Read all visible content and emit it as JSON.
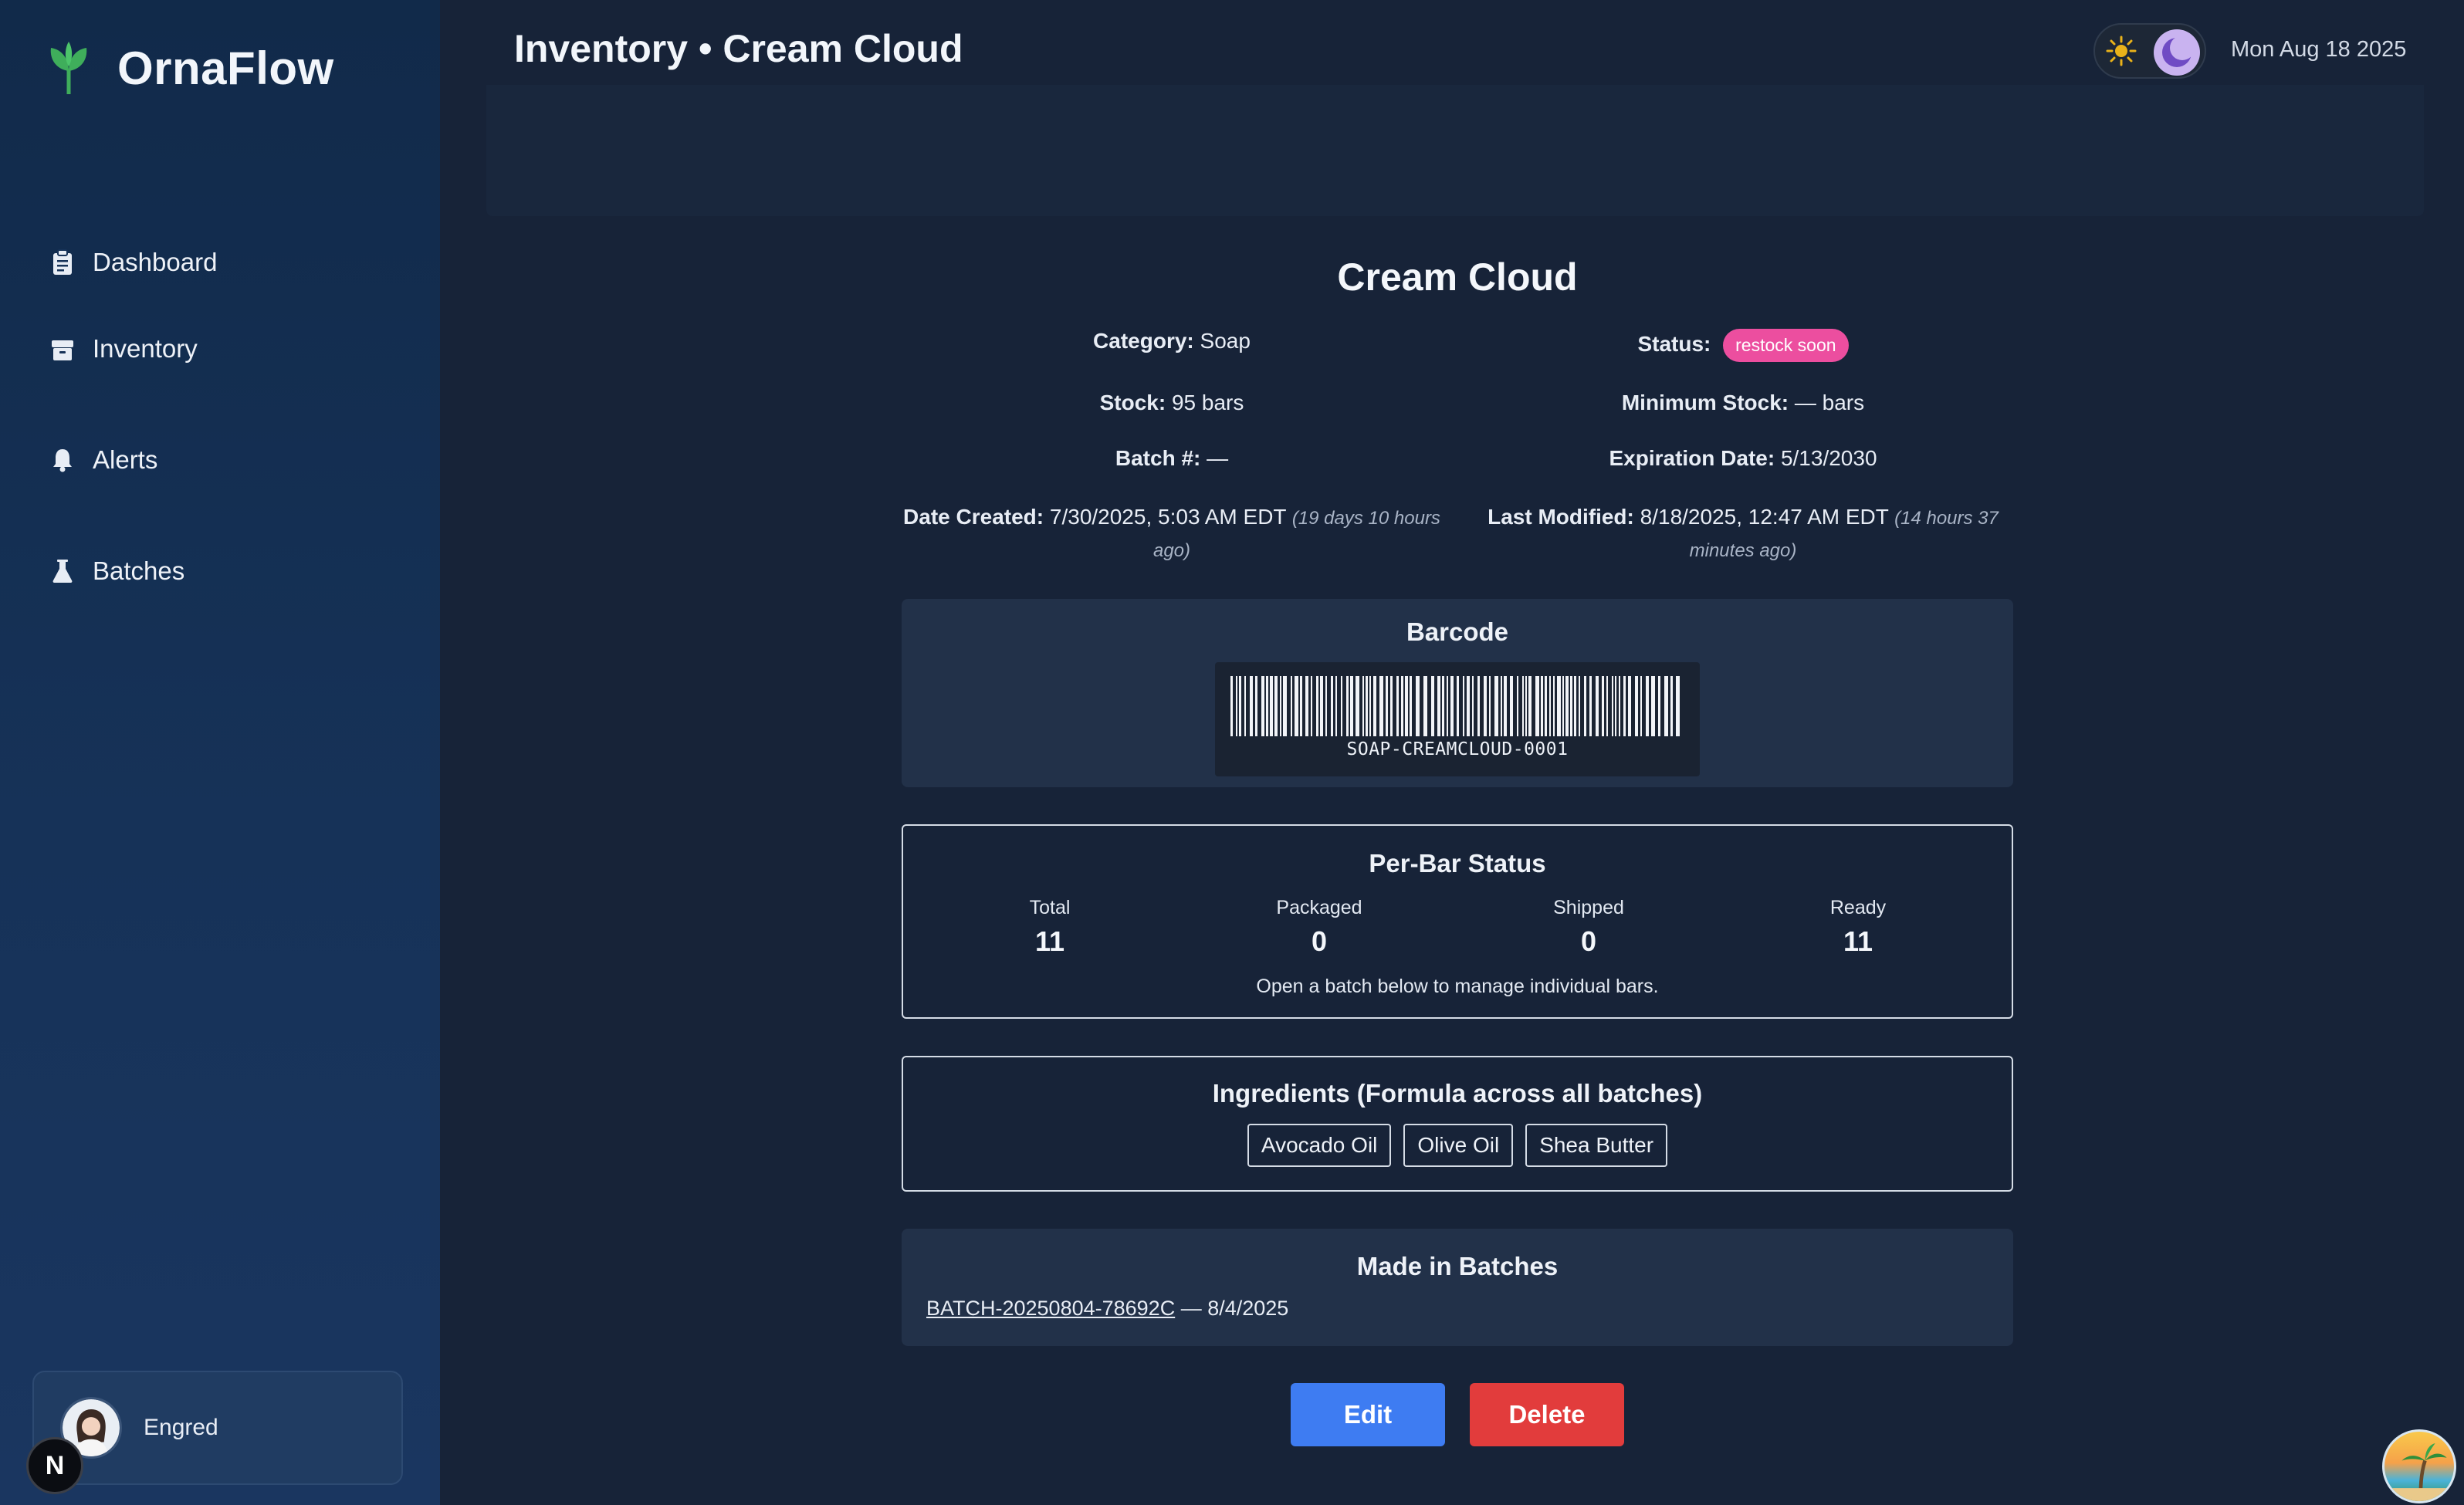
{
  "app": {
    "name": "OrnaFlow"
  },
  "sidebar": {
    "items": [
      {
        "label": "Dashboard",
        "icon": "clipboard-icon"
      },
      {
        "label": "Inventory",
        "icon": "box-icon"
      },
      {
        "label": "Alerts",
        "icon": "bell-icon"
      },
      {
        "label": "Batches",
        "icon": "flask-icon"
      }
    ],
    "user": {
      "name": "Engred"
    },
    "badge": "N"
  },
  "header": {
    "title": "Inventory • Cream Cloud",
    "date": "Mon Aug 18 2025"
  },
  "product": {
    "name": "Cream Cloud",
    "category_label": "Category:",
    "category": "Soap",
    "status_label": "Status:",
    "status": "restock soon",
    "stock_label": "Stock:",
    "stock": "95 bars",
    "min_stock_label": "Minimum Stock:",
    "min_stock": "— bars",
    "batch_label": "Batch #:",
    "batch": "—",
    "expiration_label": "Expiration Date:",
    "expiration": "5/13/2030",
    "created_label": "Date Created:",
    "created": "7/30/2025, 5:03 AM EDT",
    "created_ago_1": "(19 days 10 hours",
    "created_ago_2": "ago)",
    "modified_label": "Last Modified:",
    "modified": "8/18/2025, 12:47 AM EDT",
    "modified_ago_1": "(14 hours 37",
    "modified_ago_2": "minutes ago)"
  },
  "barcode": {
    "title": "Barcode",
    "code": "SOAP-CREAMCLOUD-0001"
  },
  "per_bar": {
    "title": "Per-Bar Status",
    "stats": [
      {
        "label": "Total",
        "value": "11"
      },
      {
        "label": "Packaged",
        "value": "0"
      },
      {
        "label": "Shipped",
        "value": "0"
      },
      {
        "label": "Ready",
        "value": "11"
      }
    ],
    "note": "Open a batch below to manage individual bars."
  },
  "ingredients": {
    "title": "Ingredients (Formula across all batches)",
    "items": [
      "Avocado Oil",
      "Olive Oil",
      "Shea Butter"
    ]
  },
  "batches": {
    "title": "Made in Batches",
    "items": [
      {
        "id": "BATCH-20250804-78692C",
        "date": " — 8/4/2025"
      }
    ]
  },
  "actions": {
    "edit": "Edit",
    "delete": "Delete"
  },
  "colors": {
    "status_pill": "#ec4e9f",
    "edit": "#3e7cf2",
    "delete": "#e23c3c",
    "brand_leaf": "#3fae5b"
  }
}
